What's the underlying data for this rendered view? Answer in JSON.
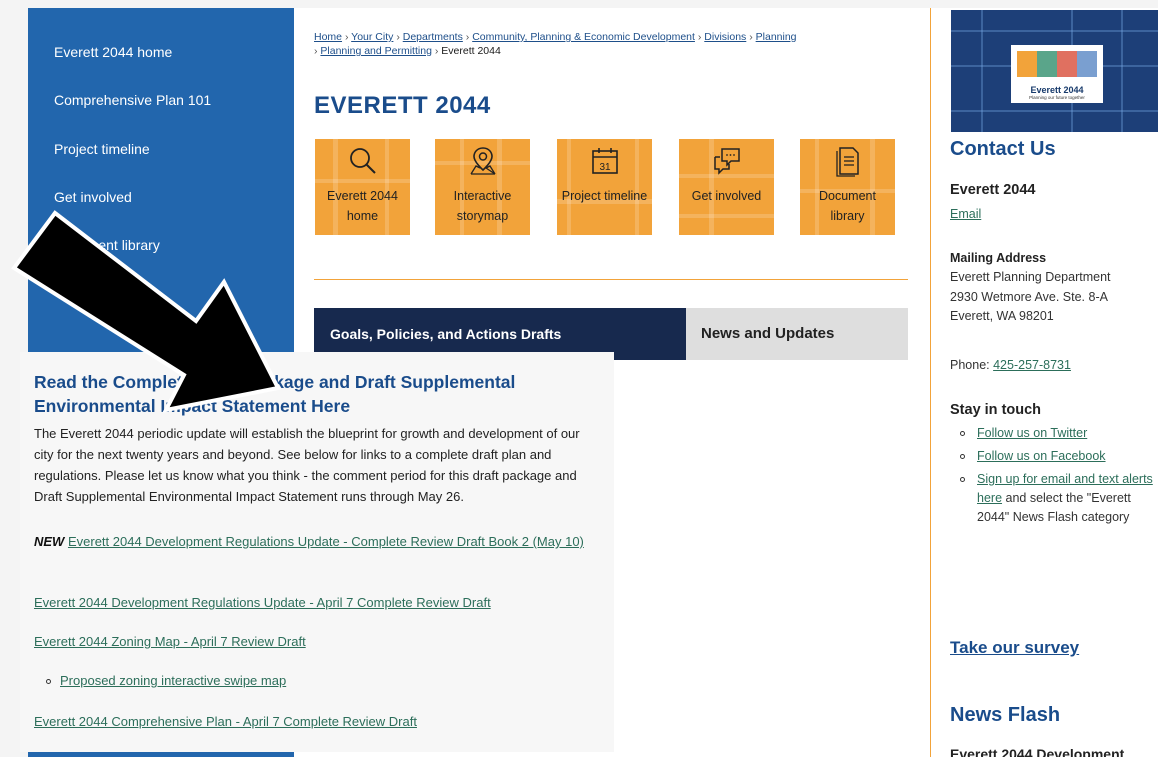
{
  "sidebar": {
    "items": [
      {
        "label": "Everett 2044 home"
      },
      {
        "label": "Comprehensive Plan 101"
      },
      {
        "label": "Project timeline"
      },
      {
        "label": "Get involved"
      },
      {
        "label": "Document library"
      }
    ]
  },
  "breadcrumb": {
    "home": "Home",
    "your_city": "Your City",
    "departments": "Departments",
    "cped": "Community, Planning & Economic Development",
    "divisions": "Divisions",
    "planning": "Planning",
    "planning_permitting": "Planning and Permitting",
    "current": "Everett 2044",
    "sep": "›"
  },
  "page_title": "EVERETT 2044",
  "tiles": [
    {
      "label": "Everett 2044 home",
      "icon": "search-icon"
    },
    {
      "label": "Interactive storymap",
      "icon": "map-pin-icon"
    },
    {
      "label": "Project timeline",
      "icon": "calendar-icon",
      "icon_text": "31"
    },
    {
      "label": "Get involved",
      "icon": "chat-bubbles-icon"
    },
    {
      "label": "Document library",
      "icon": "document-icon"
    }
  ],
  "tabs": {
    "active": "Goals, Policies, and Actions Drafts",
    "inactive": "News and Updates"
  },
  "section": {
    "title": "Read the Complete Draft Package and Draft Supplemental Environmental Impact Statement Here",
    "body": "The Everett 2044 periodic update will establish the blueprint for growth and development of our city for the next twenty years and beyond. See below for links to a complete draft plan and regulations. Please let us know what you think - the comment period for this draft package and Draft Supplemental Environmental Impact Statement runs through May 26.",
    "new_tag": "NEW",
    "links": [
      "Everett 2044 Development Regulations Update - Complete Review Draft Book 2 (May 10)",
      "Everett 2044 Development Regulations Update - April 7 Complete Review Draft",
      "Everett 2044 Zoning Map - April 7 Review Draft",
      "Everett 2044 Comprehensive Plan - April 7 Complete Review Draft"
    ],
    "sub_link": "Proposed zoning interactive swipe map"
  },
  "right": {
    "logo_title": "Everett 2044",
    "logo_sub": "Planning our future together",
    "contact_heading": "Contact Us",
    "contact_name": "Everett 2044",
    "email_label": "Email",
    "mailing_label": "Mailing Address",
    "address_line1": "Everett Planning Department",
    "address_line2": "2930 Wetmore Ave. Ste. 8-A",
    "address_line3": "Everett, WA 98201",
    "phone_label": "Phone:",
    "phone": "425-257-8731",
    "stay_heading": "Stay in touch",
    "twitter": "Follow us on Twitter",
    "facebook": "Follow us on Facebook",
    "signup_link": "Sign up for email and text alerts here",
    "signup_rest": " and select the \"Everett 2044\" News Flash category",
    "survey": "Take our survey",
    "newsflash_heading": "News Flash",
    "newsflash_item": "Everett 2044 Development"
  },
  "colors": {
    "sidebar_bg": "#2266ad",
    "tile_orange": "#f2a33a",
    "heading_blue": "#1a4c8b",
    "tab_navy": "#17294e",
    "link_green": "#2c6e5a"
  }
}
